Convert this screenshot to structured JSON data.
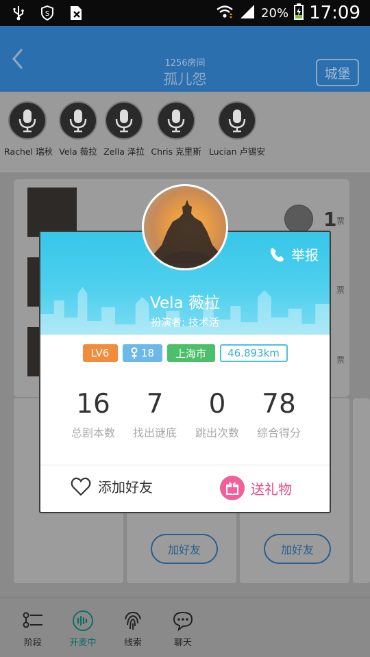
{
  "status_bar": {
    "battery": "20%",
    "time": "17:09"
  },
  "header": {
    "room_number": "1256房间",
    "title": "孤儿怨",
    "castle_button": "城堡"
  },
  "players": [
    {
      "name": "Rachel 瑞秋"
    },
    {
      "name": "Vela 薇拉"
    },
    {
      "name": "Zella 泽拉"
    },
    {
      "name": "Chris 克里斯"
    },
    {
      "name": "Lucian 卢锡安"
    }
  ],
  "vote_panel": {
    "vote_count": "1",
    "vote_unit": "票"
  },
  "cards": {
    "add_friend_label": "加好友"
  },
  "modal": {
    "report_label": "举报",
    "name": "Vela 薇拉",
    "actor": "扮演者: 技术活",
    "tags": {
      "level": "LV6",
      "age": "18",
      "city": "上海市",
      "distance": "46.893km"
    },
    "stats": [
      {
        "value": "16",
        "label": "总剧本数"
      },
      {
        "value": "7",
        "label": "找出谜底"
      },
      {
        "value": "0",
        "label": "跳出次数"
      },
      {
        "value": "78",
        "label": "综合得分"
      }
    ],
    "add_friend_label": "添加好友",
    "send_gift_label": "送礼物"
  },
  "bottom_nav": [
    {
      "label": "阶段",
      "icon": "stage-list-icon",
      "active": false
    },
    {
      "label": "开麦中",
      "icon": "mic-wave-icon",
      "active": true
    },
    {
      "label": "线索",
      "icon": "fingerprint-icon",
      "active": false
    },
    {
      "label": "聊天",
      "icon": "chat-bubble-icon",
      "active": false
    }
  ],
  "colors": {
    "header_blue": "#2b6fae",
    "modal_cyan": "#37c6e9",
    "active_green": "#0e6e66",
    "gift_pink": "#f0609b"
  }
}
